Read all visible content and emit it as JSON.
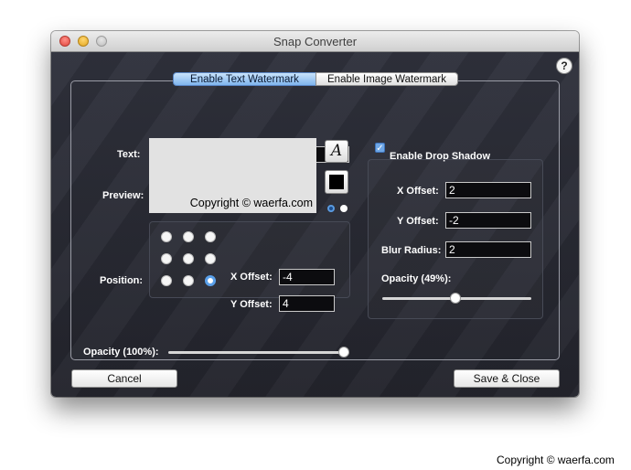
{
  "window": {
    "title": "Snap Converter"
  },
  "help": {
    "label": "?"
  },
  "tabs": [
    {
      "label": "Enable Text Watermark",
      "selected": true
    },
    {
      "label": "Enable Image Watermark",
      "selected": false
    }
  ],
  "text_section": {
    "text_label": "Text:",
    "text_value": "Copyright © waerfa.com",
    "preview_label": "Preview:",
    "preview_text": "Copyright © waerfa.com",
    "font_button_glyph": "A",
    "text_color": "#000000",
    "color_mode_selected": 0
  },
  "position_section": {
    "label": "Position:",
    "grid": [
      "top-left",
      "top-center",
      "top-right",
      "middle-left",
      "center",
      "middle-right",
      "bottom-left",
      "bottom-center",
      "bottom-right"
    ],
    "selected": "bottom-right",
    "x_offset_label": "X Offset:",
    "x_offset_value": "-4",
    "y_offset_label": "Y Offset:",
    "y_offset_value": "4"
  },
  "opacity": {
    "label": "Opacity (100%):",
    "value": 1.0
  },
  "drop_shadow": {
    "checkbox_label": "Enable Drop Shadow",
    "enabled": true,
    "x_offset_label": "X Offset:",
    "x_offset_value": "2",
    "y_offset_label": "Y Offset:",
    "y_offset_value": "-2",
    "blur_label": "Blur Radius:",
    "blur_value": "2",
    "opacity_label": "Opacity (49%):",
    "opacity_value": 0.49
  },
  "buttons": {
    "cancel": "Cancel",
    "save": "Save & Close"
  },
  "footer": {
    "copyright": "Copyright © waerfa.com"
  },
  "colors": {
    "accent": "#6fa7e6",
    "window_bg": "#2a2c35"
  }
}
